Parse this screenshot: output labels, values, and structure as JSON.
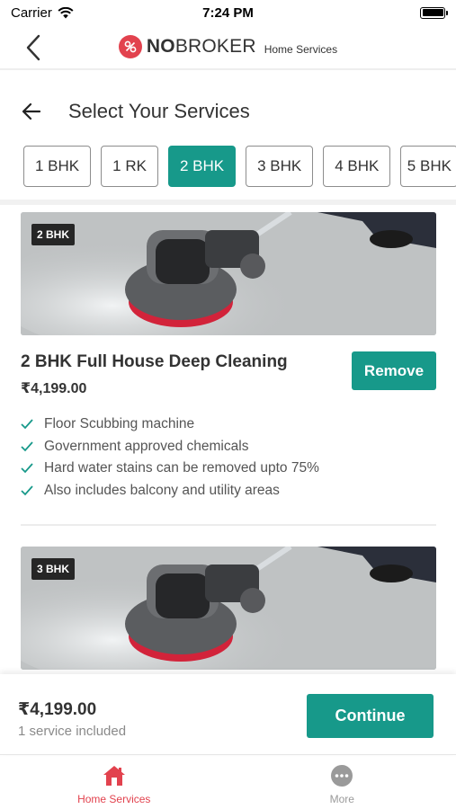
{
  "status_bar": {
    "carrier": "Carrier",
    "time": "7:24 PM"
  },
  "header": {
    "brand_bold": "NO",
    "brand_rest": "BROKER",
    "brand_sub": "Home Services"
  },
  "page": {
    "title": "Select Your Services"
  },
  "chips": [
    {
      "label": "1 BHK",
      "active": false
    },
    {
      "label": "1 RK",
      "active": false
    },
    {
      "label": "2 BHK",
      "active": true
    },
    {
      "label": "3 BHK",
      "active": false
    },
    {
      "label": "4 BHK",
      "active": false
    },
    {
      "label": "5 BHK",
      "active": false
    }
  ],
  "services": [
    {
      "badge": "2 BHK",
      "title": "2 BHK Full House Deep Cleaning",
      "price": "₹4,199.00",
      "button": "Remove",
      "features": [
        "Floor Scubbing machine",
        "Government approved chemicals",
        "Hard water stains can be removed upto 75%",
        "Also includes balcony and utility areas"
      ]
    },
    {
      "badge": "3 BHK"
    }
  ],
  "summary": {
    "total": "₹4,199.00",
    "count": "1 service included",
    "button": "Continue"
  },
  "tabbar": [
    {
      "label": "Home Services",
      "icon": "home-icon",
      "active": true
    },
    {
      "label": "More",
      "icon": "more-icon",
      "active": false
    }
  ],
  "colors": {
    "primary": "#17998a",
    "brand": "#e2424e",
    "text": "#333333",
    "muted": "#8a8a8a"
  }
}
